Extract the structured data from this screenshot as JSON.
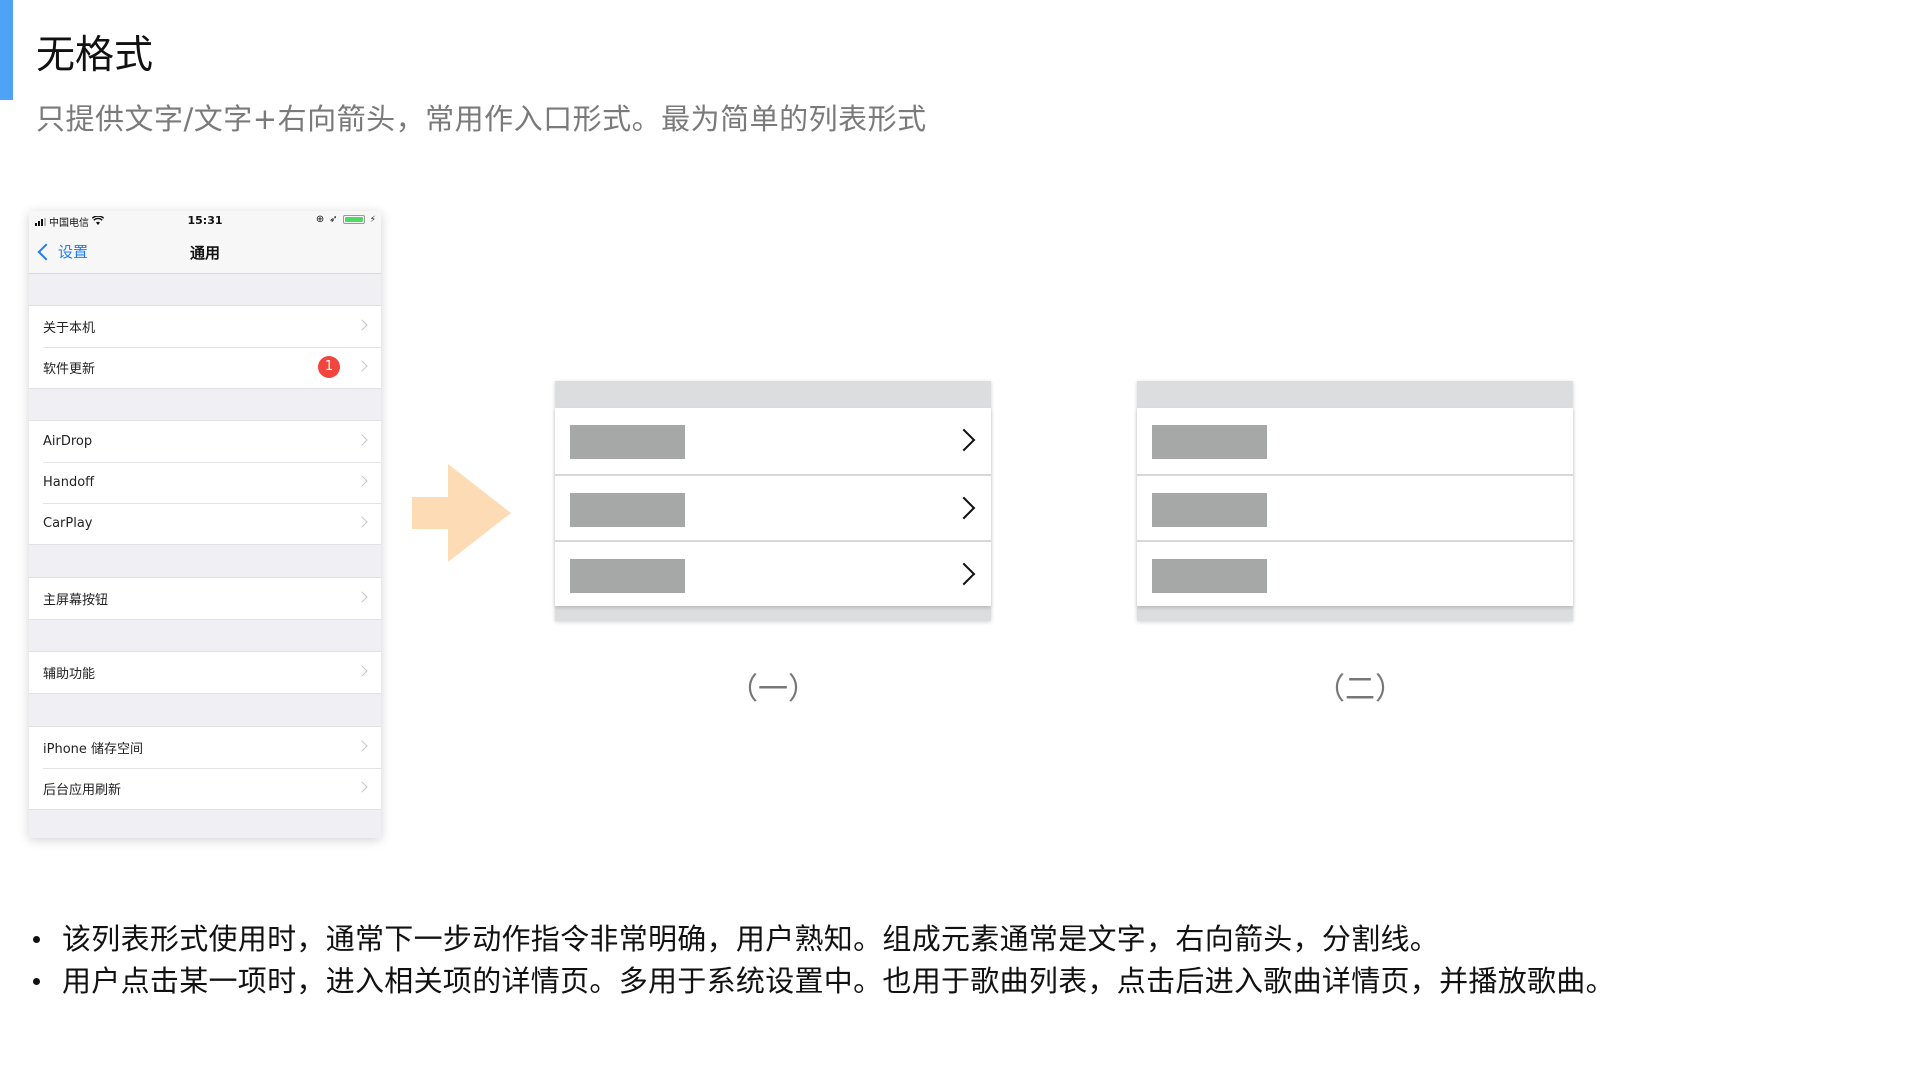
{
  "header": {
    "title": "无格式",
    "subtitle": "只提供文字/文字+右向箭头，常用作入口形式。最为简单的列表形式",
    "accent_color": "#4FA3F7"
  },
  "phone": {
    "status_bar": {
      "carrier": "中国电信",
      "time": "15:31",
      "icons": [
        "signal-icon",
        "wifi-icon",
        "orientation-lock-icon",
        "location-icon",
        "battery-icon",
        "charging-icon"
      ]
    },
    "nav": {
      "back_label": "设置",
      "title": "通用"
    },
    "groups": [
      {
        "items": [
          {
            "label": "关于本机"
          },
          {
            "label": "软件更新",
            "badge": "1"
          }
        ]
      },
      {
        "items": [
          {
            "label": "AirDrop"
          },
          {
            "label": "Handoff"
          },
          {
            "label": "CarPlay"
          }
        ]
      },
      {
        "items": [
          {
            "label": "主屏幕按钮"
          }
        ]
      },
      {
        "items": [
          {
            "label": "辅助功能"
          }
        ]
      },
      {
        "items": [
          {
            "label": "iPhone 储存空间"
          },
          {
            "label": "后台应用刷新"
          }
        ]
      }
    ]
  },
  "arrow": {
    "color": "#FDDCB5"
  },
  "wireframes": [
    {
      "caption": "（一）",
      "rows": 3,
      "has_chevron": true
    },
    {
      "caption": "（二）",
      "rows": 3,
      "has_chevron": false
    }
  ],
  "bullets": [
    "该列表形式使用时，通常下一步动作指令非常明确，用户熟知。组成元素通常是文字，右向箭头，分割线。",
    "用户点击某一项时，进入相关项的详情页。多用于系统设置中。也用于歌曲列表，点击后进入歌曲详情页，并播放歌曲。"
  ]
}
